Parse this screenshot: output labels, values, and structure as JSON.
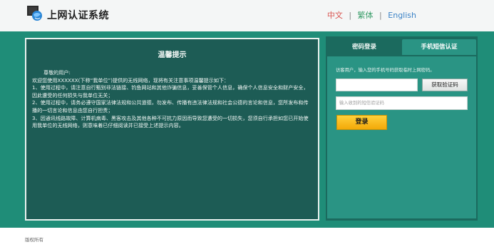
{
  "header": {
    "logo_icon": "globe-monitor-icon",
    "title": "上网认证系统",
    "languages": {
      "zh": "中文",
      "tw": "繁体",
      "en": "English",
      "separator": "|"
    }
  },
  "notice": {
    "title": "温馨提示",
    "lines": [
      "尊敬的用户:",
      "欢迎您使用XXXXXX(下称“我单位”)提供的无线网络，现将有关注意事项温馨提示如下：",
      "1、使用过程中，请注意自行甄别非法链接、钓鱼网站和其他诈骗信息，妥善保管个人信息，确保个人信息安全和财产安全，因此遭受的任何损失与我单位无关；",
      "2、使用过程中，请务必遵守国家法律法规和公共道德，勿发布、传播有违法律法规和社会公德的言论和信息，您所发布和传播的一切言论和信息由您自行担责；",
      "3、因通讯线路故障、计算机病毒、黑客攻击及其他各种不可抗力原因而导致您遭受的一切损失，您须自行承担如您已开始使用我单位的无线网络，则意味着已仔细阅读并已接受上述提示内容。"
    ]
  },
  "login": {
    "tabs": {
      "password": "密码登录",
      "sms": "手机短信认证"
    },
    "hint": "访客用户，输入您的手机号码获取临时上网密码。",
    "phone_value": "",
    "get_code_label": "获取验证码",
    "code_placeholder": "输入收到的短信验证码",
    "submit_label": "登录"
  },
  "footer": {
    "copyright": "版权所有"
  },
  "colors": {
    "band": "#1f8d78",
    "notice_bg": "#1d5c55",
    "panel_dark": "#1b6a5e",
    "panel_light": "#2a9484",
    "login_button": "#f3a908"
  }
}
